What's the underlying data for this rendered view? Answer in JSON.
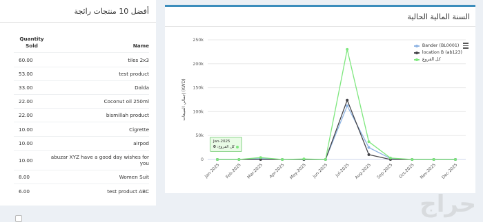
{
  "top_products": {
    "title": "أفضل 10 منتجات رائجة",
    "columns": {
      "qty": "Quantity Sold",
      "name": "Name"
    },
    "rows": [
      {
        "qty": "60.00",
        "name": "tiles 2x3"
      },
      {
        "qty": "53.00",
        "name": "test product"
      },
      {
        "qty": "33.00",
        "name": "Dalda"
      },
      {
        "qty": "22.00",
        "name": "Coconut oil 250ml"
      },
      {
        "qty": "22.00",
        "name": "bismillah product"
      },
      {
        "qty": "10.00",
        "name": "Cigrette"
      },
      {
        "qty": "10.00",
        "name": "airpod"
      },
      {
        "qty": "10.00",
        "name": "abuzar XYZ have a good day wishes for you"
      },
      {
        "qty": "8.00",
        "name": "Women Suit"
      },
      {
        "qty": "6.00",
        "name": "test product ABC"
      }
    ]
  },
  "fiscal_year": {
    "title": "السنة المالية الحالية",
    "menu_icon": "hamburger-menu-icon",
    "tooltip": {
      "month": "Jan-2025",
      "series": "كل الفروع",
      "value": "0"
    }
  },
  "watermark_text": "حراج",
  "chart_data": {
    "type": "line",
    "title": "",
    "xlabel": "",
    "ylabel": "إجمالي المبيعات (KWD)",
    "categories": [
      "Jan-2025",
      "Feb-2025",
      "Mar-2025",
      "Apr-2025",
      "May-2025",
      "Jun-2025",
      "Jul-2025",
      "Aug-2025",
      "Sep-2025",
      "Oct-2025",
      "Nov-2025",
      "Dec-2025"
    ],
    "ylim": [
      0,
      250000
    ],
    "yticks": [
      0,
      50000,
      100000,
      150000,
      200000,
      250000
    ],
    "ytick_labels": [
      "0",
      "50k",
      "100k",
      "150k",
      "200k",
      "250k"
    ],
    "grid": true,
    "legend_position": "top-right",
    "series": [
      {
        "name": "Bander (BL0001)",
        "color": "#8fb4e3",
        "values": [
          0,
          0,
          2000,
          0,
          0,
          0,
          112000,
          25000,
          2000,
          0,
          0,
          0
        ]
      },
      {
        "name": "location B (ab123)",
        "color": "#434348",
        "values": [
          0,
          0,
          0,
          0,
          0,
          0,
          124000,
          10000,
          0,
          0,
          0,
          0
        ]
      },
      {
        "name": "كل الفروع",
        "color": "#7ee77e",
        "values": [
          0,
          0,
          4000,
          0,
          1000,
          0,
          230000,
          37000,
          3000,
          0,
          0,
          0
        ]
      }
    ]
  }
}
